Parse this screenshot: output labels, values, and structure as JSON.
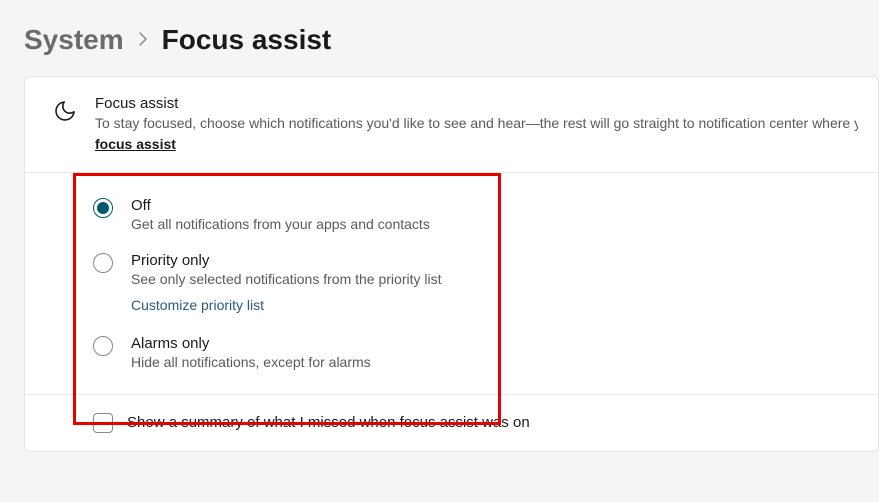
{
  "breadcrumb": {
    "parent": "System",
    "current": "Focus assist"
  },
  "header": {
    "title": "Focus assist",
    "description": "To stay focused, choose which notifications you'd like to see and hear—the rest will go straight to notification center where you can see them any time.",
    "link": "focus assist"
  },
  "radios": [
    {
      "label": "Off",
      "desc": "Get all notifications from your apps and contacts",
      "selected": true
    },
    {
      "label": "Priority only",
      "desc": "See only selected notifications from the priority list",
      "selected": false,
      "sublink": "Customize priority list"
    },
    {
      "label": "Alarms only",
      "desc": "Hide all notifications, except for alarms",
      "selected": false
    }
  ],
  "checkbox": {
    "label": "Show a summary of what I missed when focus assist was on",
    "checked": false
  }
}
